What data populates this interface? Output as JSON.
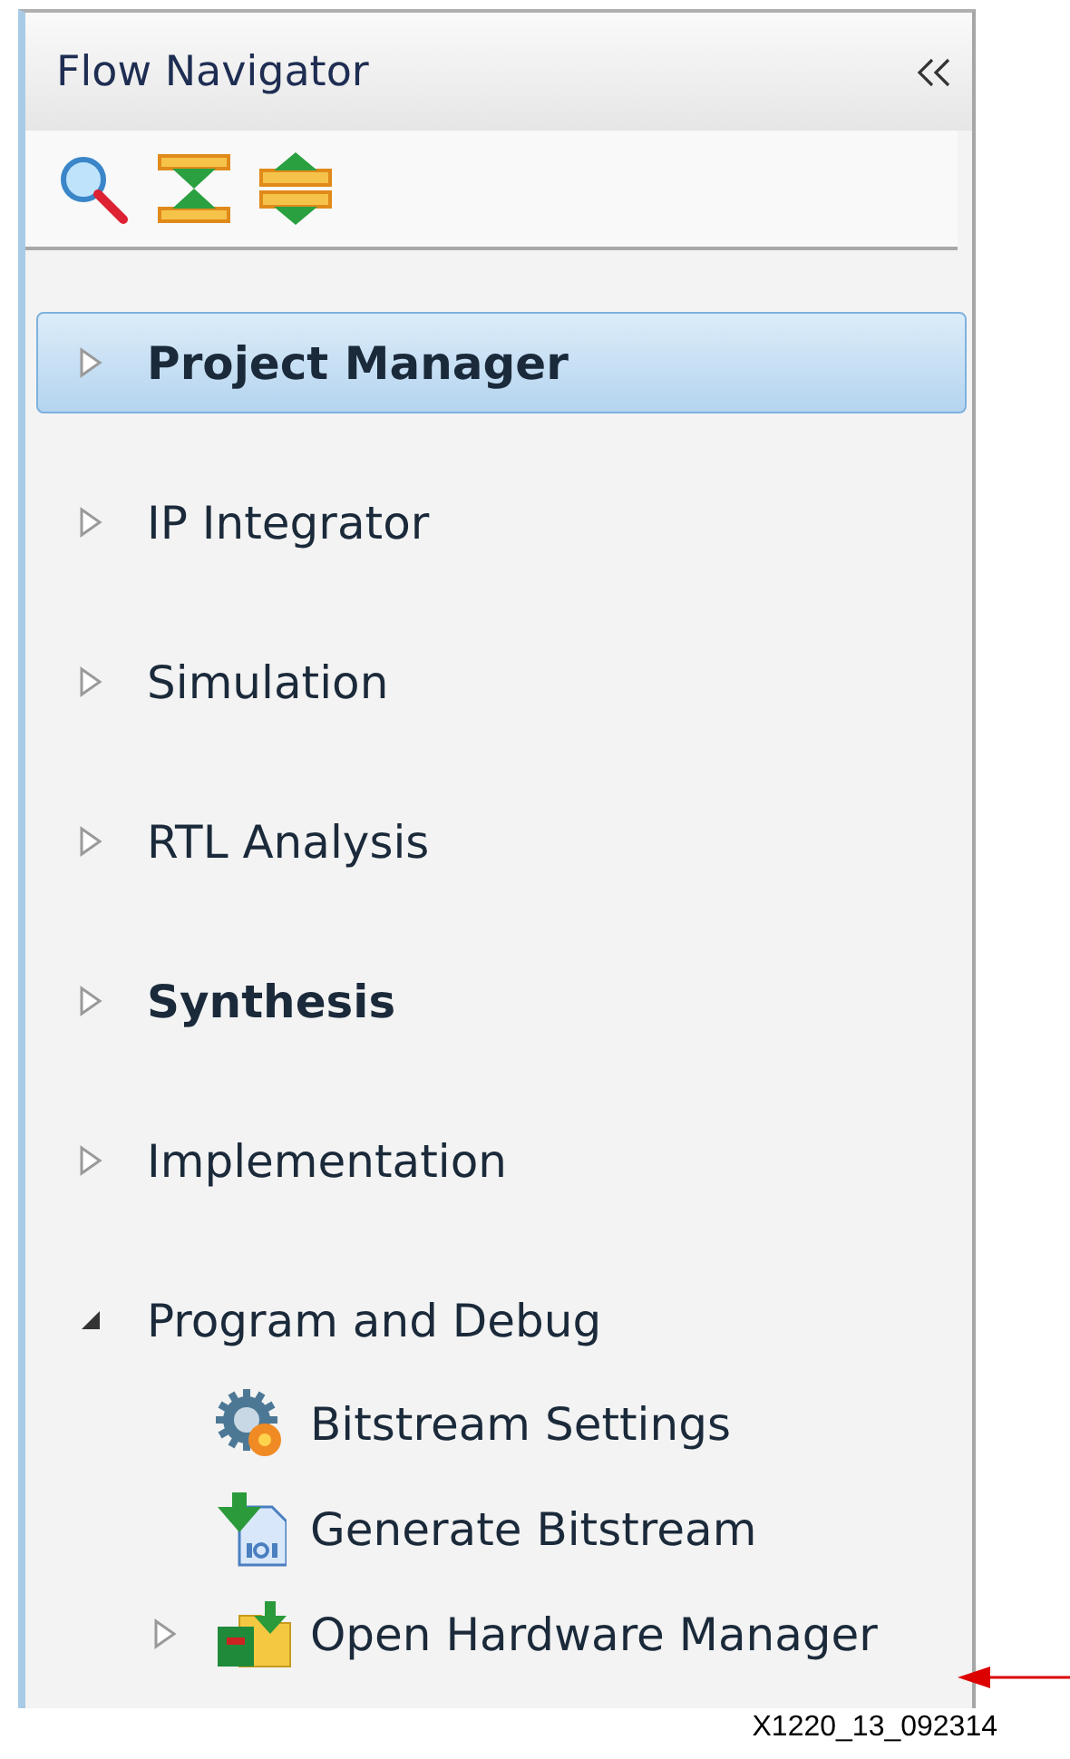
{
  "panel": {
    "title": "Flow Navigator"
  },
  "items": [
    {
      "label": "Project Manager",
      "bold": true,
      "selected": true,
      "expanded": false
    },
    {
      "label": "IP Integrator",
      "bold": false,
      "selected": false,
      "expanded": false
    },
    {
      "label": "Simulation",
      "bold": false,
      "selected": false,
      "expanded": false
    },
    {
      "label": "RTL Analysis",
      "bold": false,
      "selected": false,
      "expanded": false
    },
    {
      "label": "Synthesis",
      "bold": true,
      "selected": false,
      "expanded": false
    },
    {
      "label": "Implementation",
      "bold": false,
      "selected": false,
      "expanded": false
    },
    {
      "label": "Program and Debug",
      "bold": false,
      "selected": false,
      "expanded": true,
      "children": [
        {
          "label": "Bitstream Settings",
          "kind": "action"
        },
        {
          "label": "Generate Bitstream",
          "kind": "action"
        },
        {
          "label": "Open Hardware Manager",
          "kind": "group",
          "expanded": false
        }
      ]
    }
  ],
  "figure_label": "X1220_13_092314"
}
